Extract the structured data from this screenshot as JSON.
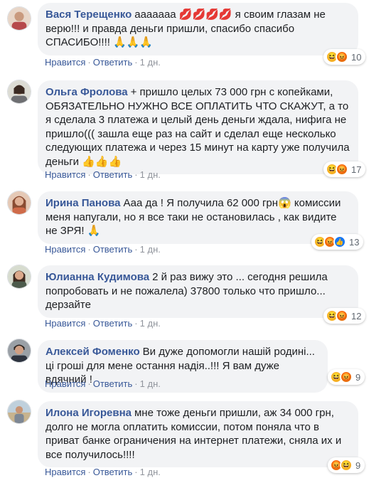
{
  "comments": [
    {
      "author": "Вася Терещенко",
      "text": "ааааааа 💋💋💋💋 я своим глазам не верю!!! и правда деньги пришли, спасибо спасибо СПАСИБО!!!! 🙏🙏🙏",
      "reaction_count": "10",
      "reactions": [
        "haha-icon",
        "angry-icon"
      ],
      "like_label": "Нравится",
      "reply_label": "Ответить",
      "time": "1 дн."
    },
    {
      "author": "Ольга Фролова",
      "text": "+ пришло целых 73 000 грн с копейками, ОБЯЗАТЕЛЬНО НУЖНО ВСЕ ОПЛАТИТЬ ЧТО СКАЖУТ, а то я сделала 3 платежа и целый день деньги ждала, нифига не пришло((( зашла еще раз на сайт и сделал еще несколько следующих платежа и через 15 минут на карту уже получила деньги 👍👍👍",
      "reaction_count": "17",
      "reactions": [
        "haha-icon",
        "angry-icon"
      ],
      "like_label": "Нравится",
      "reply_label": "Ответить",
      "time": "1 дн."
    },
    {
      "author": "Ирина Панова",
      "text": "Ааа да ! Я получила 62 000 грн😱 комиссии меня напугали, но я все таки не остановилась , как видите не ЗРЯ! 🙏",
      "reaction_count": "13",
      "reactions": [
        "haha-icon",
        "angry-icon",
        "like-icon"
      ],
      "like_label": "Нравится",
      "reply_label": "Ответить",
      "time": "1 дн."
    },
    {
      "author": "Юлианна Кудимова",
      "text": "2 й раз вижу это ... сегодня решила попробовать и не пожалела) 37800 только что пришло... дерзайте",
      "reaction_count": "12",
      "reactions": [
        "haha-icon",
        "angry-icon"
      ],
      "like_label": "Нравится",
      "reply_label": "Ответить",
      "time": "1 дн."
    },
    {
      "author": "Алексей Фоменко",
      "text": "Ви дуже допомогли нашій родині... ці гроші для мене остання надія..!!! Я вам дуже вдячний !",
      "reaction_count": "9",
      "reactions": [
        "haha-icon",
        "angry-icon"
      ],
      "like_label": "Нравится",
      "reply_label": "Ответить",
      "time": "1 дн."
    },
    {
      "author": "Илона Игоревна",
      "text": "мне тоже деньги пришли, аж 34 000 грн, долго не могла оплатить комиссии, потом поняла что в приват банке ограничения на интернет платежи, сняла их и все получилось!!!!",
      "reaction_count": "9",
      "reactions": [
        "angry-icon",
        "haha-icon"
      ],
      "like_label": "Нравится",
      "reply_label": "Ответить",
      "time": "1 дн."
    }
  ],
  "colors": {
    "author_link": "#385898",
    "bubble_bg": "#f2f3f5",
    "meta_text": "#90949c"
  }
}
